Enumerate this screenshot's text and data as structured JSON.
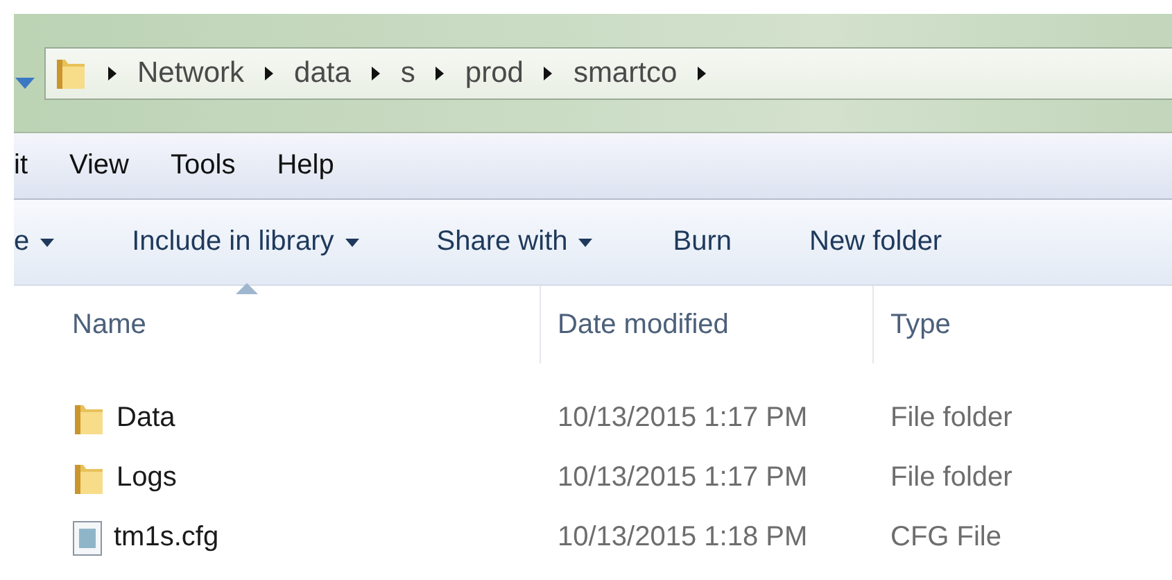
{
  "address_bar": {
    "segments": [
      "Network",
      "data",
      "s",
      "prod",
      "smartco"
    ]
  },
  "menu_bar": [
    "it",
    "View",
    "Tools",
    "Help"
  ],
  "toolbar": [
    {
      "label": "e",
      "dropdown": true
    },
    {
      "label": "Include in library",
      "dropdown": true
    },
    {
      "label": "Share with",
      "dropdown": true
    },
    {
      "label": "Burn",
      "dropdown": false
    },
    {
      "label": "New folder",
      "dropdown": false
    }
  ],
  "columns": [
    {
      "label": "Name",
      "sorted": true
    },
    {
      "label": "Date modified",
      "sorted": false
    },
    {
      "label": "Type",
      "sorted": false
    }
  ],
  "rows": [
    {
      "kind": "folder",
      "name": "Data",
      "date": "10/13/2015 1:17 PM",
      "type": "File folder"
    },
    {
      "kind": "folder",
      "name": "Logs",
      "date": "10/13/2015 1:17 PM",
      "type": "File folder"
    },
    {
      "kind": "file",
      "name": "tm1s.cfg",
      "date": "10/13/2015 1:18 PM",
      "type": "CFG File"
    }
  ]
}
